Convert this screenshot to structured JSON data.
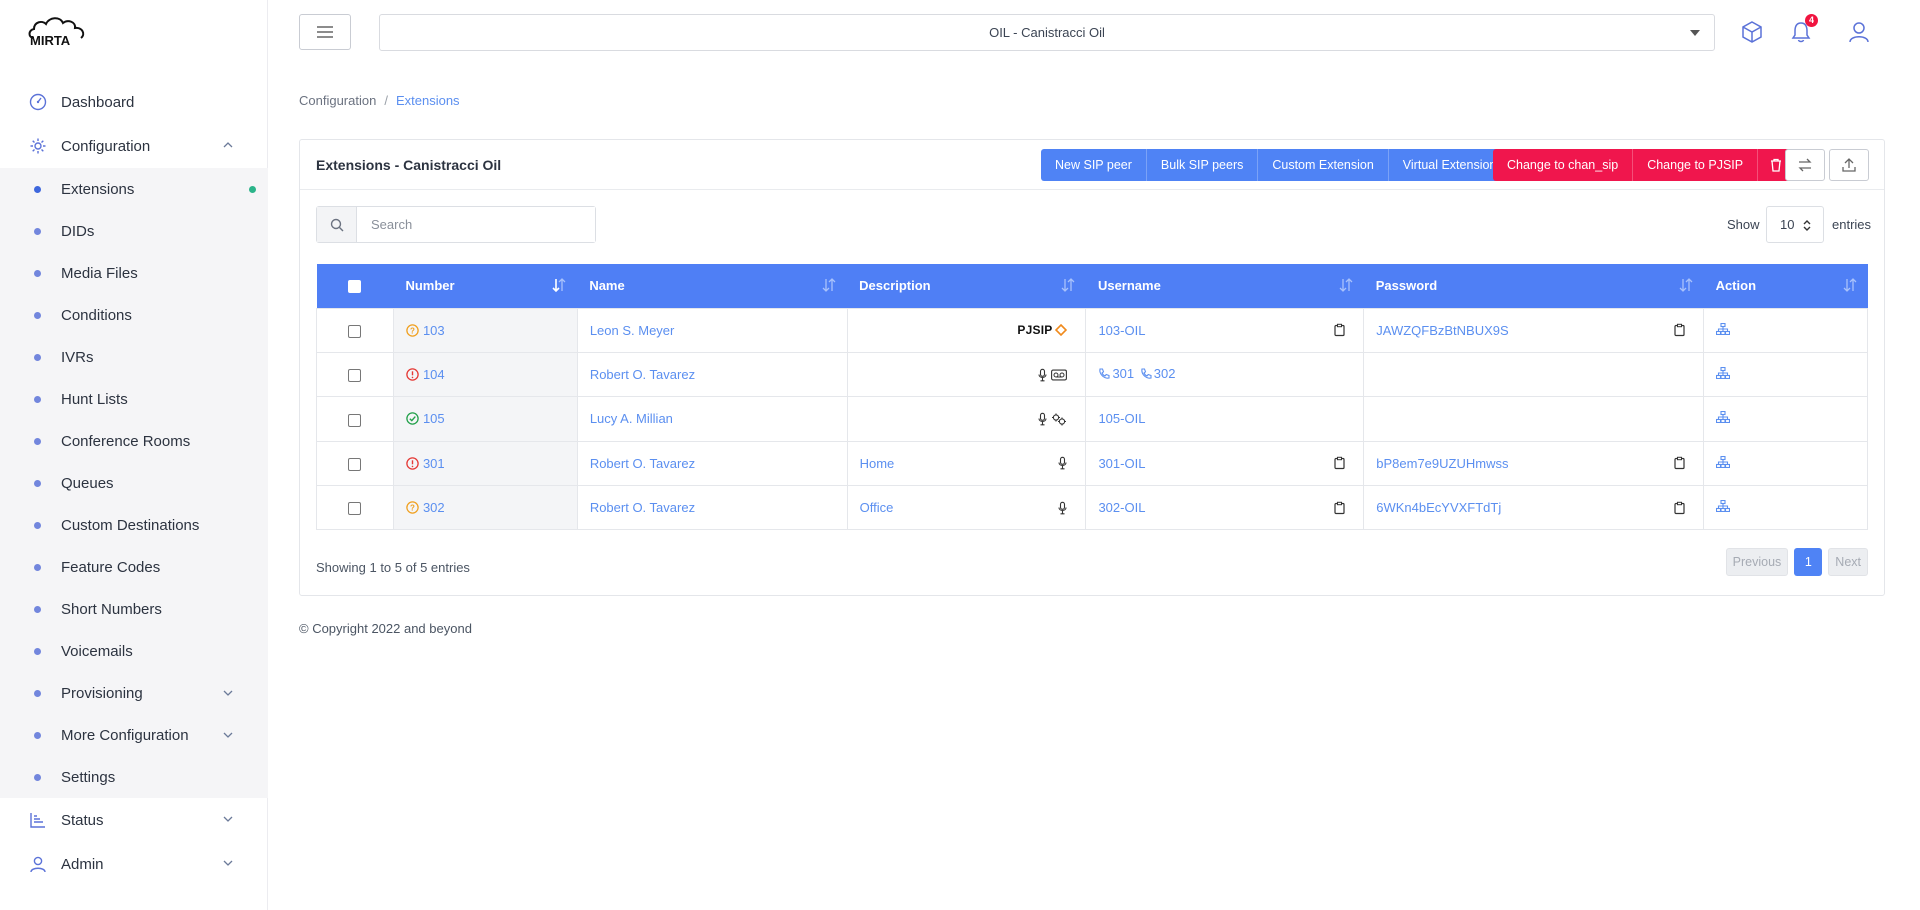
{
  "app": {
    "logo_text": "MIRTA"
  },
  "sidebar": {
    "items": [
      {
        "label": "Dashboard",
        "icon": "dashboard-icon"
      },
      {
        "label": "Configuration",
        "icon": "gear-icon",
        "expanded": true
      }
    ],
    "configuration_sub": [
      {
        "label": "Extensions",
        "active": true
      },
      {
        "label": "DIDs"
      },
      {
        "label": "Media Files"
      },
      {
        "label": "Conditions"
      },
      {
        "label": "IVRs"
      },
      {
        "label": "Hunt Lists"
      },
      {
        "label": "Conference Rooms"
      },
      {
        "label": "Queues"
      },
      {
        "label": "Custom Destinations"
      },
      {
        "label": "Feature Codes"
      },
      {
        "label": "Short Numbers"
      },
      {
        "label": "Voicemails"
      },
      {
        "label": "Provisioning",
        "has_children": true
      },
      {
        "label": "More Configuration",
        "has_children": true
      },
      {
        "label": "Settings"
      }
    ],
    "bottom_items": [
      {
        "label": "Status",
        "icon": "chart-icon"
      },
      {
        "label": "Admin",
        "icon": "user-icon"
      }
    ]
  },
  "header": {
    "tenant": "OIL - Canistracci Oil",
    "notifications_count": "4"
  },
  "breadcrumb": {
    "parent": "Configuration",
    "separator": "/",
    "current": "Extensions"
  },
  "card": {
    "title": "Extensions - Canistracci Oil",
    "buttons_blue": [
      "New SIP peer",
      "Bulk SIP peers",
      "Custom Extension",
      "Virtual Extension"
    ],
    "buttons_red": [
      "Change to chan_sip",
      "Change to PJSIP"
    ]
  },
  "search": {
    "placeholder": "Search",
    "value": ""
  },
  "page_size": {
    "label_before": "Show",
    "value": "10",
    "label_after": "entries"
  },
  "table": {
    "headers": [
      "Number",
      "Name",
      "Description",
      "Username",
      "Password",
      "Action"
    ],
    "rows": [
      {
        "status": "warning",
        "number": "103",
        "name": "Leon S. Meyer",
        "description": "",
        "desc_badge": "PJSIP",
        "username": "103-OIL",
        "password": "JAWZQFBzBtNBUX9S"
      },
      {
        "status": "error",
        "number": "104",
        "name": "Robert O. Tavarez",
        "description": "",
        "desc_badge": "",
        "linked": [
          "301",
          "302"
        ],
        "username": "",
        "password": ""
      },
      {
        "status": "ok",
        "number": "105",
        "name": "Lucy A. Millian",
        "description": "",
        "desc_badge": "",
        "username": "105-OIL",
        "password": ""
      },
      {
        "status": "error",
        "number": "301",
        "name": "Robert O. Tavarez",
        "description": "Home",
        "desc_badge": "",
        "username": "301-OIL",
        "password": "bP8em7e9UZUHmwss"
      },
      {
        "status": "warning",
        "number": "302",
        "name": "Robert O. Tavarez",
        "description": "Office",
        "desc_badge": "",
        "username": "302-OIL",
        "password": "6WKn4bEcYVXFTdTj"
      }
    ]
  },
  "pagination": {
    "info": "Showing 1 to 5 of 5 entries",
    "previous": "Previous",
    "current": "1",
    "next": "Next"
  },
  "footer": {
    "copyright": "© Copyright 2022 and beyond"
  },
  "colors": {
    "primary": "#4f83f5",
    "danger": "#f0164d",
    "ok": "#22a04a",
    "warning": "#f0a020",
    "error": "#e53935"
  }
}
